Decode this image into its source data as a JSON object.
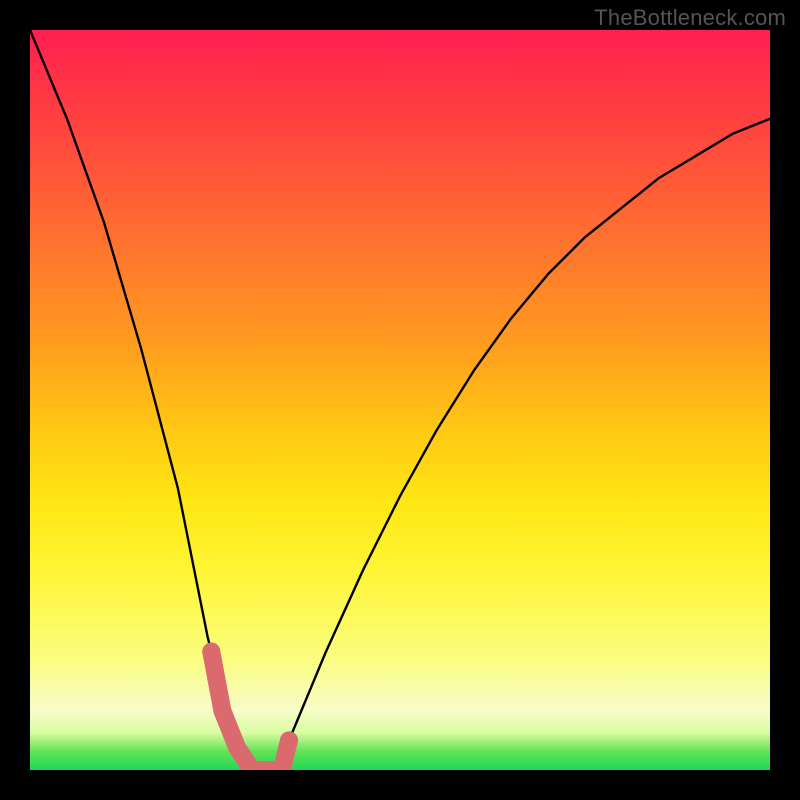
{
  "watermark": "TheBottleneck.com",
  "chart_data": {
    "type": "line",
    "title": "",
    "xlabel": "",
    "ylabel": "",
    "ylim": [
      0,
      100
    ],
    "x": [
      0.0,
      0.05,
      0.1,
      0.15,
      0.2,
      0.24,
      0.26,
      0.28,
      0.3,
      0.32,
      0.34,
      0.35,
      0.4,
      0.45,
      0.5,
      0.55,
      0.6,
      0.65,
      0.7,
      0.75,
      0.8,
      0.85,
      0.9,
      0.95,
      1.0
    ],
    "values": [
      100,
      88,
      74,
      57,
      38,
      18,
      10,
      4,
      0,
      0,
      0,
      4,
      16,
      27,
      37,
      46,
      54,
      61,
      67,
      72,
      76,
      80,
      83,
      86,
      88
    ],
    "series": [
      {
        "name": "curve",
        "x_ref": "x",
        "y_ref": "values"
      }
    ],
    "highlight": {
      "x": [
        0.245,
        0.26,
        0.28,
        0.3,
        0.32,
        0.34,
        0.35
      ],
      "values": [
        16,
        8,
        3,
        0,
        0,
        0,
        4
      ]
    },
    "colors": {
      "curve": "#000000",
      "highlight": "#db6a6f",
      "top": "#ff1f51",
      "bottom": "#1ed957"
    }
  }
}
